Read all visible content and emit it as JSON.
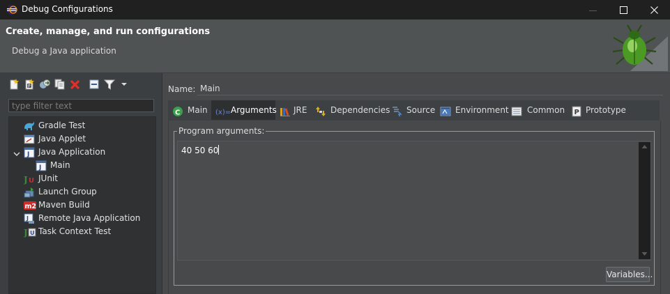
{
  "window": {
    "title": "Debug Configurations",
    "controls": {
      "minimize": "minimize-icon",
      "maximize": "maximize-icon",
      "close": "close-icon"
    }
  },
  "header": {
    "title": "Create, manage, and run configurations",
    "subtitle": "Debug a Java application",
    "icon": "debug-bug-icon"
  },
  "left_panel": {
    "toolbar": [
      {
        "name": "new-configuration",
        "icon": "new-configuration-icon"
      },
      {
        "name": "new-prototype",
        "icon": "new-prototype-icon"
      },
      {
        "name": "export",
        "icon": "export-icon"
      },
      {
        "name": "duplicate",
        "icon": "duplicate-icon"
      },
      {
        "name": "delete",
        "icon": "delete-icon"
      },
      {
        "name": "collapse-all",
        "icon": "collapse-all-icon"
      },
      {
        "name": "filter",
        "icon": "filter-icon"
      },
      {
        "name": "menu",
        "icon": "chevron-down-icon"
      }
    ],
    "filter_placeholder": "type filter text",
    "tree": [
      {
        "label": "Gradle Test",
        "icon": "gradle-icon",
        "level": 0
      },
      {
        "label": "Java Applet",
        "icon": "java-applet-icon",
        "level": 0
      },
      {
        "label": "Java Application",
        "icon": "java-application-icon",
        "level": 0,
        "expanded": true
      },
      {
        "label": "Main",
        "icon": "java-application-icon",
        "level": 1
      },
      {
        "label": "JUnit",
        "icon": "junit-icon",
        "level": 0
      },
      {
        "label": "Launch Group",
        "icon": "launch-group-icon",
        "level": 0
      },
      {
        "label": "Maven Build",
        "icon": "maven-icon",
        "level": 0
      },
      {
        "label": "Remote Java Application",
        "icon": "remote-java-icon",
        "level": 0
      },
      {
        "label": "Task Context Test",
        "icon": "task-context-icon",
        "level": 0
      }
    ]
  },
  "right_panel": {
    "name_label": "Name:",
    "name_value": "Main",
    "tabs": [
      {
        "label": "Main",
        "icon": "main-class-icon",
        "active": false
      },
      {
        "label": "Arguments",
        "icon": "arguments-icon",
        "active": true
      },
      {
        "label": "JRE",
        "icon": "jre-library-icon",
        "active": false
      },
      {
        "label": "Dependencies",
        "icon": "dependencies-icon",
        "active": false
      },
      {
        "label": "Source",
        "icon": "source-icon",
        "active": false
      },
      {
        "label": "Environment",
        "icon": "environment-icon",
        "active": false
      },
      {
        "label": "Common",
        "icon": "common-icon",
        "active": false
      },
      {
        "label": "Prototype",
        "icon": "prototype-icon",
        "active": false
      }
    ],
    "program_arguments": {
      "label": "Program arguments:",
      "value": "40 50 60",
      "variables_button": "Variables..."
    }
  }
}
